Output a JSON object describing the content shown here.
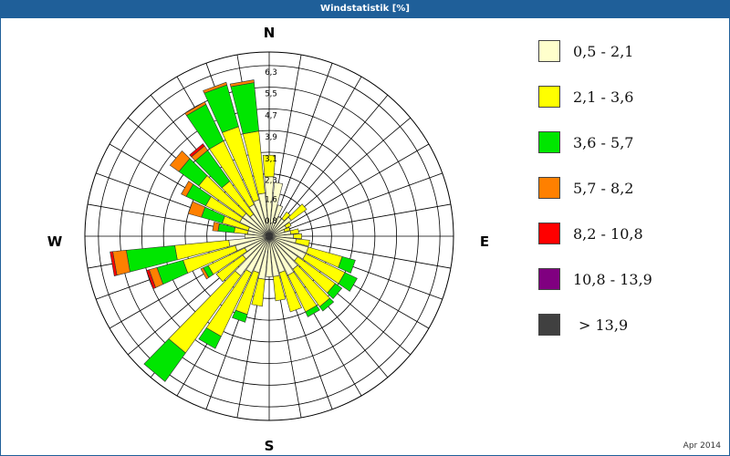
{
  "window": {
    "title": "Windstatistik [%]"
  },
  "footer": {
    "date": "Apr 2014"
  },
  "chart_data": {
    "type": "wind-rose",
    "title": "Windstatistik [%]",
    "unit": "%",
    "compass": {
      "north": "N",
      "east": "E",
      "south": "S",
      "west": "W"
    },
    "rings": [
      0.8,
      1.6,
      2.3,
      3.1,
      3.9,
      4.7,
      5.5,
      6.3
    ],
    "ring_labels": [
      "0,8",
      "1,6",
      "2,3",
      "3,1",
      "3,9",
      "4,7",
      "5,5",
      "6,3"
    ],
    "r_max": 6.8,
    "sector_count": 36,
    "sector_start_deg": 0,
    "speed_classes": [
      {
        "label": "0,5 - 2,1",
        "color": "#ffffcc"
      },
      {
        "label": "2,1 - 3,6",
        "color": "#ffff00"
      },
      {
        "label": "3,6 - 5,7",
        "color": "#00e600"
      },
      {
        "label": "5,7 - 8,2",
        "color": "#ff8000"
      },
      {
        "label": "8,2 - 10,8",
        "color": "#ff0000"
      },
      {
        "label": "10,8 - 13,9",
        "color": "#800080"
      },
      {
        "label": "> 13,9",
        "color": "#404040"
      }
    ],
    "sectors": [
      {
        "direction_deg": 0,
        "values": [
          2.2,
          0.8,
          0.0
        ]
      },
      {
        "direction_deg": 10,
        "values": [
          2.0,
          0.0,
          0.0
        ]
      },
      {
        "direction_deg": 20,
        "values": [
          1.2,
          0.0,
          0.0
        ]
      },
      {
        "direction_deg": 30,
        "values": [
          0.8,
          0.0,
          0.0
        ]
      },
      {
        "direction_deg": 40,
        "values": [
          0.8,
          0.3,
          0.0
        ]
      },
      {
        "direction_deg": 50,
        "values": [
          1.0,
          0.7,
          0.0
        ]
      },
      {
        "direction_deg": 60,
        "values": [
          0.7,
          0.2,
          0.0
        ]
      },
      {
        "direction_deg": 70,
        "values": [
          0.6,
          0.2,
          0.0
        ]
      },
      {
        "direction_deg": 80,
        "values": [
          0.8,
          0.3,
          0.0
        ]
      },
      {
        "direction_deg": 90,
        "values": [
          0.9,
          0.3,
          0.0
        ]
      },
      {
        "direction_deg": 100,
        "values": [
          1.0,
          0.5,
          0.0
        ]
      },
      {
        "direction_deg": 110,
        "values": [
          1.5,
          1.3,
          0.5
        ]
      },
      {
        "direction_deg": 120,
        "values": [
          1.5,
          1.6,
          0.5
        ]
      },
      {
        "direction_deg": 130,
        "values": [
          1.3,
          1.7,
          0.3
        ]
      },
      {
        "direction_deg": 140,
        "values": [
          1.5,
          1.7,
          0.2
        ]
      },
      {
        "direction_deg": 150,
        "values": [
          1.6,
          1.5,
          0.2
        ]
      },
      {
        "direction_deg": 160,
        "values": [
          1.4,
          1.5,
          0.0
        ]
      },
      {
        "direction_deg": 170,
        "values": [
          1.5,
          0.9,
          0.0
        ]
      },
      {
        "direction_deg": 180,
        "values": [
          1.5,
          0.0,
          0.0
        ]
      },
      {
        "direction_deg": 190,
        "values": [
          1.6,
          1.0,
          0.0
        ]
      },
      {
        "direction_deg": 200,
        "values": [
          1.4,
          1.6,
          0.3
        ]
      },
      {
        "direction_deg": 210,
        "values": [
          1.5,
          2.6,
          0.5
        ]
      },
      {
        "direction_deg": 220,
        "values": [
          1.8,
          3.5,
          1.3
        ]
      },
      {
        "direction_deg": 230,
        "values": [
          1.2,
          1.2,
          0.0
        ]
      },
      {
        "direction_deg": 240,
        "values": [
          1.0,
          1.5,
          0.2,
          0.1
        ]
      },
      {
        "direction_deg": 250,
        "values": [
          1.3,
          2.0,
          1.0,
          0.3,
          0.1
        ]
      },
      {
        "direction_deg": 260,
        "values": [
          1.5,
          2.0,
          1.8,
          0.5,
          0.1
        ]
      },
      {
        "direction_deg": 270,
        "values": [
          0.9,
          0.0,
          0.0
        ]
      },
      {
        "direction_deg": 280,
        "values": [
          0.8,
          0.5,
          0.6,
          0.2
        ]
      },
      {
        "direction_deg": 290,
        "values": [
          0.8,
          1.0,
          0.8,
          0.5
        ]
      },
      {
        "direction_deg": 300,
        "values": [
          1.2,
          1.4,
          0.8,
          0.2
        ]
      },
      {
        "direction_deg": 310,
        "values": [
          1.2,
          2.0,
          0.9,
          0.4
        ]
      },
      {
        "direction_deg": 320,
        "values": [
          1.0,
          1.5,
          1.4,
          0.2,
          0.1
        ]
      },
      {
        "direction_deg": 330,
        "values": [
          1.3,
          2.6,
          1.5,
          0.1
        ]
      },
      {
        "direction_deg": 340,
        "values": [
          1.4,
          2.8,
          1.6,
          0.1
        ]
      },
      {
        "direction_deg": 350,
        "values": [
          1.6,
          2.3,
          1.8,
          0.1
        ]
      }
    ],
    "legend_position": "right"
  }
}
